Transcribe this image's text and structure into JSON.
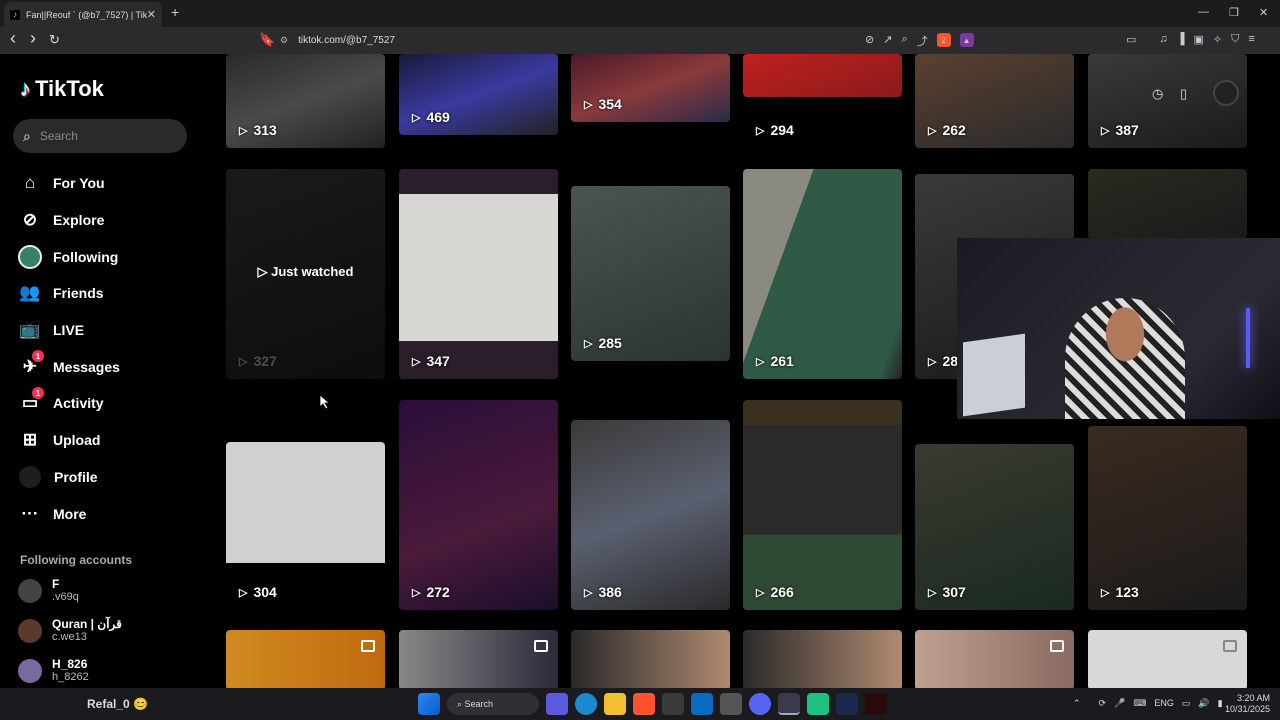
{
  "browser": {
    "tab_title": "Fan||Reouf ` (@b7_7527) | TikT",
    "url": "tiktok.com/@b7_7527",
    "back": "‹",
    "forward": "›",
    "reload": "↻",
    "new_tab": "+",
    "win_min": "—",
    "win_max": "❐",
    "win_close": "✕",
    "brave_badge": "2"
  },
  "sidebar": {
    "logo_text": "TikTok",
    "search_placeholder": "Search",
    "items": [
      {
        "label": "For You",
        "icon": "home-icon"
      },
      {
        "label": "Explore",
        "icon": "compass-icon"
      },
      {
        "label": "Following",
        "icon": "following-avatar-icon"
      },
      {
        "label": "Friends",
        "icon": "friends-icon"
      },
      {
        "label": "LIVE",
        "icon": "live-icon"
      },
      {
        "label": "Messages",
        "icon": "messages-icon",
        "badge": "1"
      },
      {
        "label": "Activity",
        "icon": "activity-icon",
        "badge": "1"
      },
      {
        "label": "Upload",
        "icon": "upload-icon"
      },
      {
        "label": "Profile",
        "icon": "profile-icon"
      },
      {
        "label": "More",
        "icon": "more-icon"
      }
    ],
    "following_title": "Following accounts",
    "accounts": [
      {
        "name": "F",
        "handle": ".v69q",
        "color": "#444"
      },
      {
        "name": "Quran | قرآن",
        "handle": "c.we13",
        "color": "#5a3a2a"
      },
      {
        "name": "H_826",
        "handle": "h_8262",
        "color": "#7a6aa0"
      }
    ]
  },
  "grid": {
    "just_watched": "Just watched",
    "rows": [
      [
        "313",
        "469",
        "354",
        "294",
        "262",
        "387"
      ],
      [
        "327",
        "347",
        "285",
        "261",
        "28",
        ""
      ],
      [
        "304",
        "272",
        "386",
        "266",
        "307",
        "123"
      ]
    ]
  },
  "colors": {
    "accent": "#fe2c55",
    "cyan": "#25f4ee"
  },
  "taskbar": {
    "user": "Refal_0 😊",
    "search": "Search",
    "lang": "ENG",
    "time": "3:20 AM",
    "date": "10/31/2025"
  }
}
